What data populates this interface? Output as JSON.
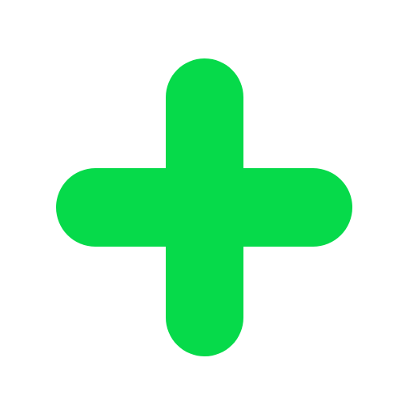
{
  "icon": {
    "name": "plus-icon",
    "color": "#06DA4A",
    "background": "#FFFFFF"
  }
}
